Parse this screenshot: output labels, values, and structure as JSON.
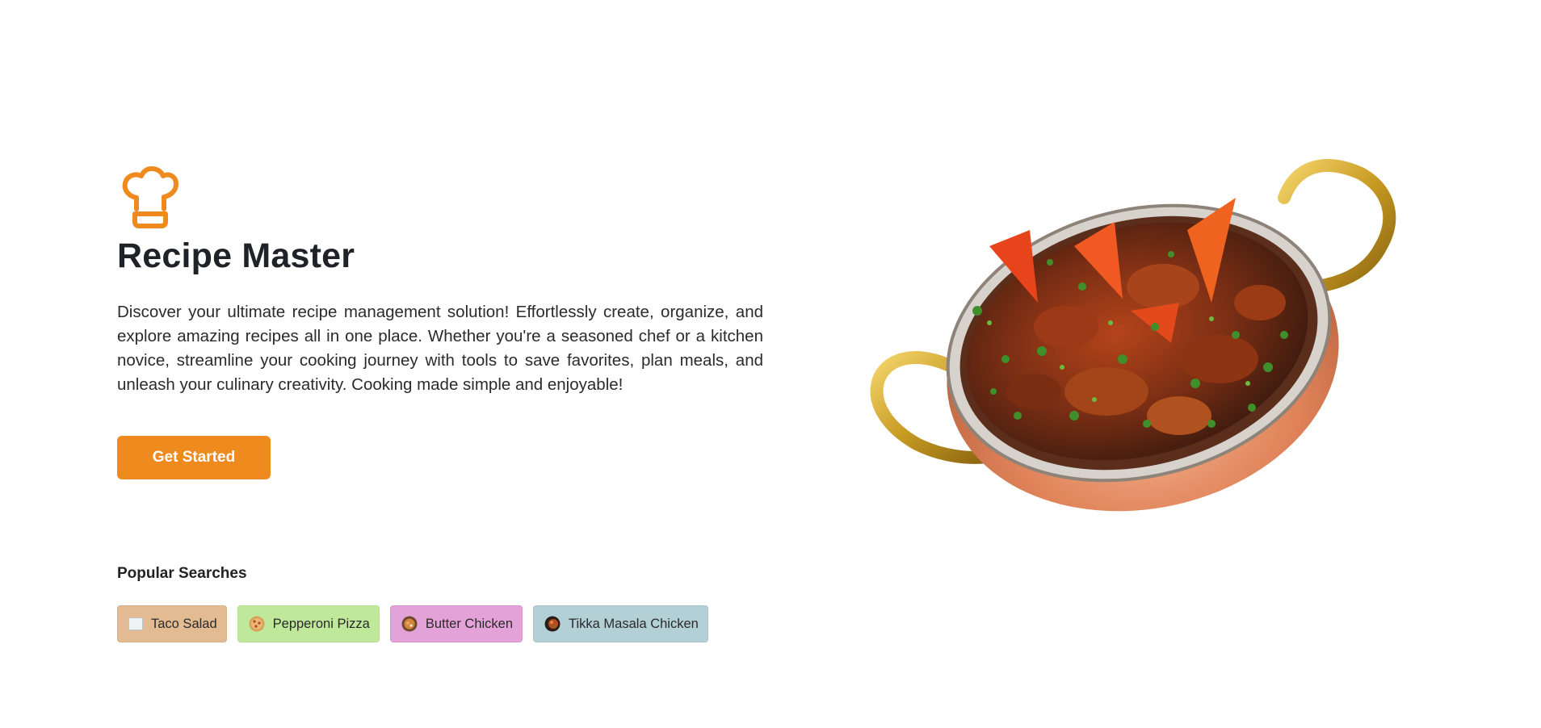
{
  "brand": {
    "logo_icon": "chef-hat-icon",
    "accent_color": "#ee8a1e",
    "title": "Recipe Master"
  },
  "hero": {
    "description": "Discover your ultimate recipe management solution! Effortlessly create, organize, and explore amazing recipes all in one place. Whether you're a seasoned chef or a kitchen novice, streamline your cooking journey with tools to save favorites, plan meals, and unleash your culinary creativity. Cooking made simple and enjoyable!",
    "cta_label": "Get Started",
    "image_icon": "curry-bowl-image"
  },
  "popular": {
    "title": "Popular Searches",
    "items": [
      {
        "label": "Taco Salad",
        "color": "#e2bb92"
      },
      {
        "label": "Pepperoni Pizza",
        "color": "#bfe89b"
      },
      {
        "label": "Butter Chicken",
        "color": "#e3a2d8"
      },
      {
        "label": "Tikka Masala Chicken",
        "color": "#b3d0d6"
      }
    ]
  }
}
